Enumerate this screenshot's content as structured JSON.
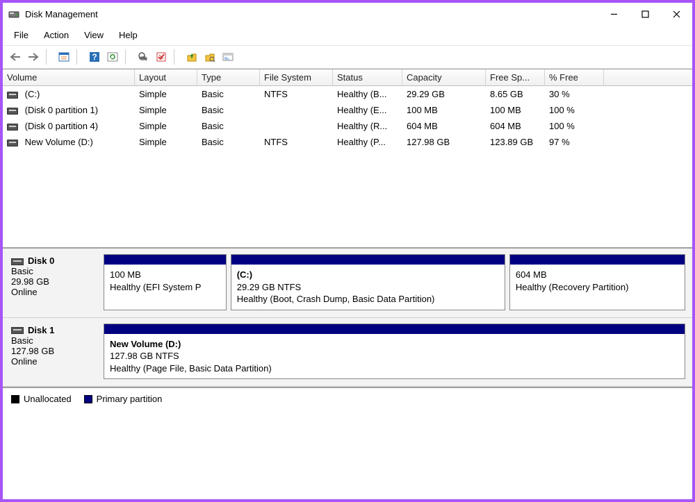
{
  "window": {
    "title": "Disk Management"
  },
  "menu": {
    "file": "File",
    "action": "Action",
    "view": "View",
    "help": "Help"
  },
  "table": {
    "headers": {
      "volume": "Volume",
      "layout": "Layout",
      "type": "Type",
      "fs": "File System",
      "status": "Status",
      "capacity": "Capacity",
      "free": "Free Sp...",
      "pct": "% Free"
    },
    "rows": [
      {
        "volume": " (C:)",
        "layout": "Simple",
        "type": "Basic",
        "fs": "NTFS",
        "status": "Healthy (B...",
        "capacity": "29.29 GB",
        "free": "8.65 GB",
        "pct": "30 %"
      },
      {
        "volume": " (Disk 0 partition 1)",
        "layout": "Simple",
        "type": "Basic",
        "fs": "",
        "status": "Healthy (E...",
        "capacity": "100 MB",
        "free": "100 MB",
        "pct": "100 %"
      },
      {
        "volume": " (Disk 0 partition 4)",
        "layout": "Simple",
        "type": "Basic",
        "fs": "",
        "status": "Healthy (R...",
        "capacity": "604 MB",
        "free": "604 MB",
        "pct": "100 %"
      },
      {
        "volume": " New Volume (D:)",
        "layout": "Simple",
        "type": "Basic",
        "fs": "NTFS",
        "status": "Healthy (P...",
        "capacity": "127.98 GB",
        "free": "123.89 GB",
        "pct": "97 %"
      }
    ]
  },
  "disks": [
    {
      "name": "Disk 0",
      "type": "Basic",
      "size": "29.98 GB",
      "status": "Online",
      "partitions": [
        {
          "label": "",
          "size_line": "100 MB",
          "status_line": "Healthy (EFI System P",
          "flex": 16
        },
        {
          "label": " (C:)",
          "size_line": "29.29 GB NTFS",
          "status_line": "Healthy (Boot, Crash Dump, Basic Data Partition)",
          "flex": 36
        },
        {
          "label": "",
          "size_line": "604 MB",
          "status_line": "Healthy (Recovery Partition)",
          "flex": 23
        }
      ]
    },
    {
      "name": "Disk 1",
      "type": "Basic",
      "size": "127.98 GB",
      "status": "Online",
      "partitions": [
        {
          "label": "New Volume  (D:)",
          "size_line": "127.98 GB NTFS",
          "status_line": "Healthy (Page File, Basic Data Partition)",
          "flex": 1
        }
      ]
    }
  ],
  "legend": {
    "unallocated": "Unallocated",
    "primary": "Primary partition"
  }
}
